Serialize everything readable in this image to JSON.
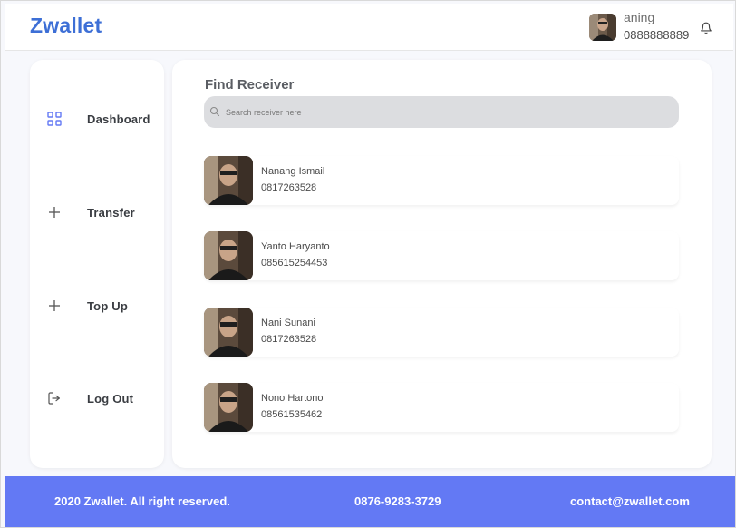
{
  "header": {
    "logo": "Zwallet",
    "user": {
      "name": "aning",
      "phone": "0888888889"
    },
    "icons": {
      "avatar": "user-avatar-photo",
      "notification": "bell-icon"
    }
  },
  "sidebar": {
    "items": [
      {
        "label": "Dashboard",
        "icon": "grid-icon",
        "active": true
      },
      {
        "label": "Transfer",
        "icon": "plus-icon"
      },
      {
        "label": "Top Up",
        "icon": "plus-icon"
      },
      {
        "label": "Log Out",
        "icon": "logout-icon"
      }
    ]
  },
  "main": {
    "title": "Find Receiver",
    "search": {
      "placeholder": "Search receiver here",
      "value": ""
    },
    "receivers": [
      {
        "name": "Nanang Ismail",
        "phone": "0817263528"
      },
      {
        "name": "Yanto Haryanto",
        "phone": "085615254453"
      },
      {
        "name": "Nani Sunani",
        "phone": "0817263528"
      },
      {
        "name": "Nono Hartono",
        "phone": "08561535462"
      }
    ]
  },
  "footer": {
    "copyright": "2020 Zwallet. All right reserved.",
    "phone": "0876-9283-3729",
    "email": "contact@zwallet.com"
  },
  "colors": {
    "brand": "#3d6fd6",
    "accent_footer": "#6379f4",
    "icon_active": "#6379f4",
    "search_bg": "#dcdde0"
  }
}
